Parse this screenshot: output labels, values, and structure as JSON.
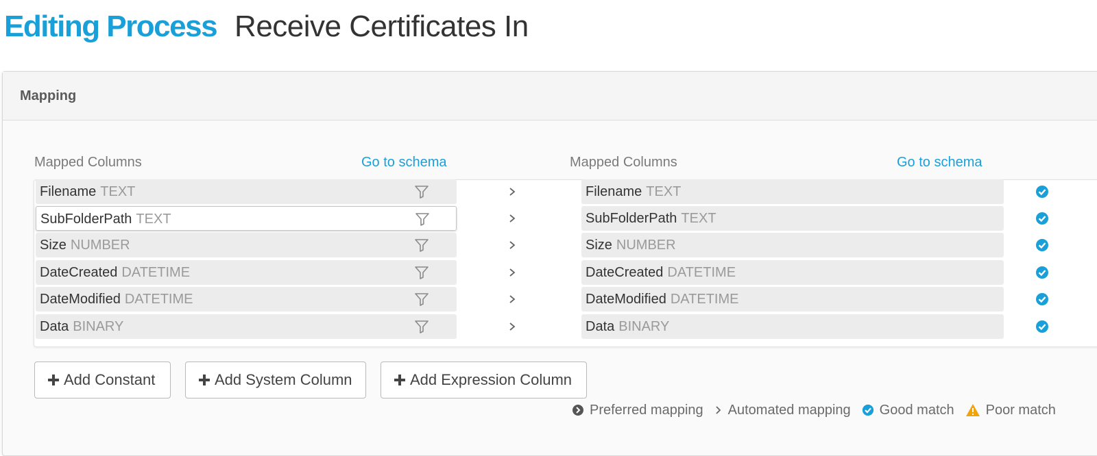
{
  "header": {
    "mode_label": "Editing Process",
    "process_name": "Receive Certificates In"
  },
  "panel": {
    "title": "Mapping"
  },
  "left": {
    "header": "Mapped Columns",
    "link": "Go to schema"
  },
  "right": {
    "header": "Mapped Columns",
    "link": "Go to schema"
  },
  "rows": [
    {
      "src_name": "Filename",
      "src_type": "TEXT",
      "dst_name": "Filename",
      "dst_type": "TEXT",
      "selected": false,
      "match": "good"
    },
    {
      "src_name": "SubFolderPath",
      "src_type": "TEXT",
      "dst_name": "SubFolderPath",
      "dst_type": "TEXT",
      "selected": true,
      "match": "good"
    },
    {
      "src_name": "Size",
      "src_type": "NUMBER",
      "dst_name": "Size",
      "dst_type": "NUMBER",
      "selected": false,
      "match": "good"
    },
    {
      "src_name": "DateCreated",
      "src_type": "DATETIME",
      "dst_name": "DateCreated",
      "dst_type": "DATETIME",
      "selected": false,
      "match": "good"
    },
    {
      "src_name": "DateModified",
      "src_type": "DATETIME",
      "dst_name": "DateModified",
      "dst_type": "DATETIME",
      "selected": false,
      "match": "good"
    },
    {
      "src_name": "Data",
      "src_type": "BINARY",
      "dst_name": "Data",
      "dst_type": "BINARY",
      "selected": false,
      "match": "good"
    }
  ],
  "buttons": {
    "add_constant": "Add Constant",
    "add_system_column": "Add System Column",
    "add_expression_column": "Add Expression Column"
  },
  "legend": {
    "preferred": "Preferred mapping",
    "automated": "Automated mapping",
    "good": "Good match",
    "poor": "Poor match"
  },
  "icons": {
    "filter": "filter-icon",
    "arrow": "chevron-right-icon",
    "check": "check-circle-icon",
    "plus": "plus-icon",
    "warning": "warning-triangle-icon"
  },
  "colors": {
    "accent": "#1aa0d8",
    "good_match": "#1aa0d8",
    "poor_match": "#f0a30a"
  }
}
